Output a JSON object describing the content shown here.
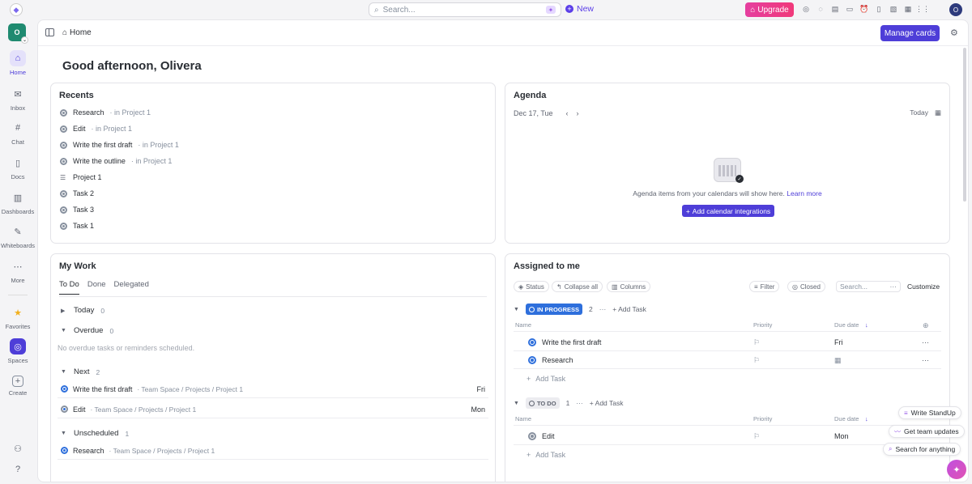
{
  "topbar": {
    "search_placeholder": "Search...",
    "new_label": "New",
    "upgrade_label": "Upgrade",
    "avatar_initial": "O"
  },
  "sidebar": {
    "workspace_initial": "O",
    "items": [
      {
        "label": "Home",
        "icon": "home-icon"
      },
      {
        "label": "Inbox",
        "icon": "inbox-icon"
      },
      {
        "label": "Chat",
        "icon": "hash-icon"
      },
      {
        "label": "Docs",
        "icon": "doc-icon"
      },
      {
        "label": "Dashboards",
        "icon": "dashboard-icon"
      },
      {
        "label": "Whiteboards",
        "icon": "whiteboard-icon"
      },
      {
        "label": "More",
        "icon": "more-icon"
      },
      {
        "label": "Favorites",
        "icon": "star-icon"
      },
      {
        "label": "Spaces",
        "icon": "compass-icon"
      },
      {
        "label": "Create",
        "icon": "plus-icon"
      }
    ]
  },
  "header": {
    "breadcrumb": "Home",
    "manage_cards": "Manage cards"
  },
  "greeting": "Good afternoon, Olivera",
  "recents": {
    "title": "Recents",
    "items": [
      {
        "name": "Research",
        "loc": "· in Project 1"
      },
      {
        "name": "Edit",
        "loc": "· in Project 1"
      },
      {
        "name": "Write the first draft",
        "loc": "· in Project 1"
      },
      {
        "name": "Write the outline",
        "loc": "· in Project 1"
      },
      {
        "name": "Project 1",
        "loc": ""
      },
      {
        "name": "Task 2",
        "loc": ""
      },
      {
        "name": "Task 3",
        "loc": ""
      },
      {
        "name": "Task 1",
        "loc": ""
      }
    ]
  },
  "agenda": {
    "title": "Agenda",
    "date": "Dec 17, Tue",
    "today": "Today",
    "empty_text": "Agenda items from your calendars will show here.",
    "learn_more": "Learn more",
    "add_button": "Add calendar integrations"
  },
  "mywork": {
    "title": "My Work",
    "tabs": [
      "To Do",
      "Done",
      "Delegated"
    ],
    "today": {
      "label": "Today",
      "count": "0"
    },
    "overdue": {
      "label": "Overdue",
      "count": "0",
      "empty": "No overdue tasks or reminders scheduled."
    },
    "next": {
      "label": "Next",
      "count": "2"
    },
    "next_tasks": [
      {
        "name": "Write the first draft",
        "path": "· Team Space / Projects / Project 1",
        "due": "Fri"
      },
      {
        "name": "Edit",
        "path": "· Team Space / Projects / Project 1",
        "due": "Mon"
      }
    ],
    "unscheduled": {
      "label": "Unscheduled",
      "count": "1"
    },
    "unscheduled_tasks": [
      {
        "name": "Research",
        "path": "· Team Space / Projects / Project 1",
        "due": ""
      }
    ]
  },
  "assigned": {
    "title": "Assigned to me",
    "chips": [
      "Status",
      "Collapse all",
      "Columns",
      "Filter",
      "Closed"
    ],
    "search_placeholder": "Search...",
    "customize": "Customize",
    "columns": {
      "name": "Name",
      "priority": "Priority",
      "due": "Due date"
    },
    "in_progress": {
      "label": "IN PROGRESS",
      "count": "2",
      "color": "#2e6fdc",
      "tasks": [
        {
          "name": "Write the first draft",
          "due": "Fri"
        },
        {
          "name": "Research",
          "due": ""
        }
      ]
    },
    "todo": {
      "label": "TO DO",
      "count": "1",
      "color": "#87909e",
      "tasks": [
        {
          "name": "Edit",
          "due": "Mon"
        }
      ]
    },
    "add_task": "Add Task",
    "add_task_short": "Add Task"
  },
  "floating": {
    "standup": "Write StandUp",
    "updates": "Get team updates",
    "search": "Search for anything"
  },
  "colors": {
    "accent": "#4e3ed8",
    "upgrade": "#ea3d8f",
    "in_progress": "#2e6fdc"
  }
}
